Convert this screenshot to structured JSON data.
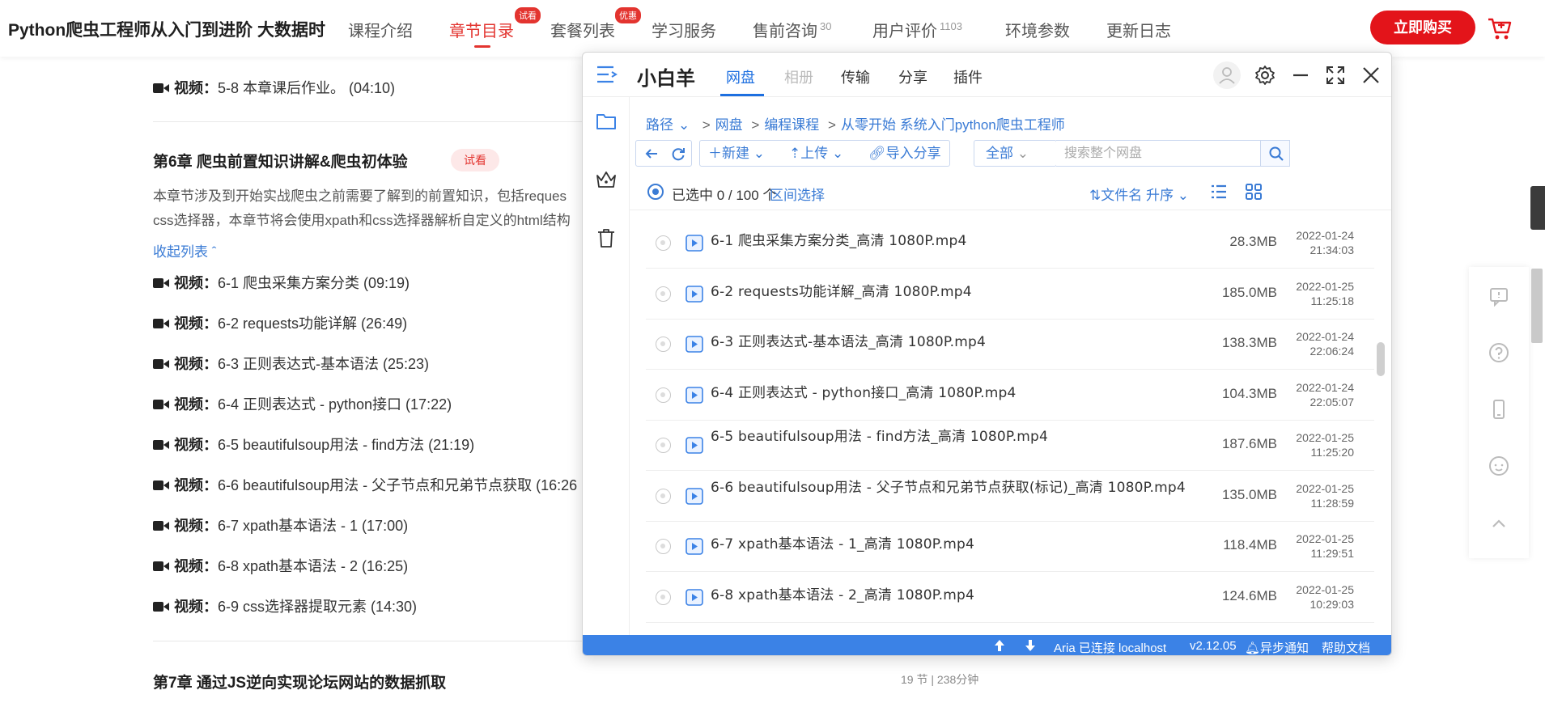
{
  "topnav": {
    "site_title": "Python爬虫工程师从入门到进阶 大数据时",
    "links": [
      {
        "label": "课程介绍"
      },
      {
        "label": "章节目录",
        "badge": "试看"
      },
      {
        "label": "套餐列表",
        "badge": "优惠"
      },
      {
        "label": "学习服务"
      },
      {
        "label": "售前咨询",
        "sup": "30"
      },
      {
        "label": "用户评价",
        "sup": "1103"
      },
      {
        "label": "环境参数"
      },
      {
        "label": "更新日志"
      }
    ],
    "buy_label": "立即购买"
  },
  "course": {
    "prev_lesson": {
      "kw": "视频：",
      "text": "5-8 本章课后作业。 (04:10)"
    },
    "chapter6": {
      "title": "第6章 爬虫前置知识讲解&爬虫初体验",
      "tag": "试看",
      "desc_line1": "本章节涉及到开始实战爬虫之前需要了解到的前置知识，包括reques",
      "desc_line2": "css选择器，本章节将会使用xpath和css选择器解析自定义的html结构",
      "collapse": "收起列表",
      "lessons": [
        {
          "kw": "视频：",
          "text": "6-1 爬虫采集方案分类 (09:19)"
        },
        {
          "kw": "视频：",
          "text": "6-2 requests功能详解 (26:49)"
        },
        {
          "kw": "视频：",
          "text": "6-3 正则表达式-基本语法 (25:23)"
        },
        {
          "kw": "视频：",
          "text": "6-4 正则表达式 - python接口 (17:22)"
        },
        {
          "kw": "视频：",
          "text": "6-5 beautifulsoup用法 - find方法 (21:19)"
        },
        {
          "kw": "视频：",
          "text": "6-6 beautifulsoup用法 - 父子节点和兄弟节点获取 (16:26"
        },
        {
          "kw": "视频：",
          "text": "6-7 xpath基本语法 - 1 (17:00)"
        },
        {
          "kw": "视频：",
          "text": "6-8 xpath基本语法 - 2 (16:25)"
        },
        {
          "kw": "视频：",
          "text": "6-9 css选择器提取元素 (14:30)"
        }
      ]
    },
    "chapter7": {
      "title": "第7章 通过JS逆向实现论坛网站的数据抓取",
      "meta": "19 节 | 238分钟"
    }
  },
  "panel": {
    "brand": "小白羊",
    "tabs": [
      {
        "label": "网盘",
        "state": "active"
      },
      {
        "label": "相册",
        "state": "disabled"
      },
      {
        "label": "传输",
        "state": "normal"
      },
      {
        "label": "分享",
        "state": "normal"
      },
      {
        "label": "插件",
        "state": "normal"
      }
    ],
    "breadcrumb": [
      "路径",
      "网盘",
      "编程课程",
      "从零开始 系统入门python爬虫工程师"
    ],
    "toolbar": {
      "new_label": "新建",
      "upload_label": "上传",
      "import_label": "导入分享",
      "scope_label": "全部",
      "search_placeholder": "搜索整个网盘"
    },
    "selection": {
      "text": "已选中 0 / 100 个",
      "range_label": "区间选择",
      "sort_label": "文件名 升序"
    },
    "files": [
      {
        "name": "6-1 爬虫采集方案分类_高清 1080P.mp4",
        "size": "28.3MB",
        "date": "2022-01-24",
        "time": "21:34:03"
      },
      {
        "name": "6-2 requests功能详解_高清 1080P.mp4",
        "size": "185.0MB",
        "date": "2022-01-25",
        "time": "11:25:18"
      },
      {
        "name": "6-3 正则表达式-基本语法_高清 1080P.mp4",
        "size": "138.3MB",
        "date": "2022-01-24",
        "time": "22:06:24"
      },
      {
        "name": "6-4 正则表达式 - python接口_高清 1080P.mp4",
        "size": "104.3MB",
        "date": "2022-01-24",
        "time": "22:05:07"
      },
      {
        "name": "6-5 beautifulsoup用法 - find方法_高清 1080P.mp4",
        "size": "187.6MB",
        "date": "2022-01-25",
        "time": "11:25:20"
      },
      {
        "name": "6-6 beautifulsoup用法 - 父子节点和兄弟节点获取(标记)_高清 1080P.mp4",
        "size": "135.0MB",
        "date": "2022-01-25",
        "time": "11:28:59"
      },
      {
        "name": "6-7 xpath基本语法 - 1_高清 1080P.mp4",
        "size": "118.4MB",
        "date": "2022-01-25",
        "time": "11:29:51"
      },
      {
        "name": "6-8 xpath基本语法 - 2_高清 1080P.mp4",
        "size": "124.6MB",
        "date": "2022-01-25",
        "time": "10:29:03"
      }
    ],
    "status": {
      "aria": "Aria 已连接 localhost",
      "version": "v2.12.05",
      "notify": "异步通知",
      "help": "帮助文档"
    }
  },
  "colors": {
    "accent_red": "#e3342f",
    "panel_blue": "#3b82e6",
    "link_blue": "#3a7bd5"
  }
}
